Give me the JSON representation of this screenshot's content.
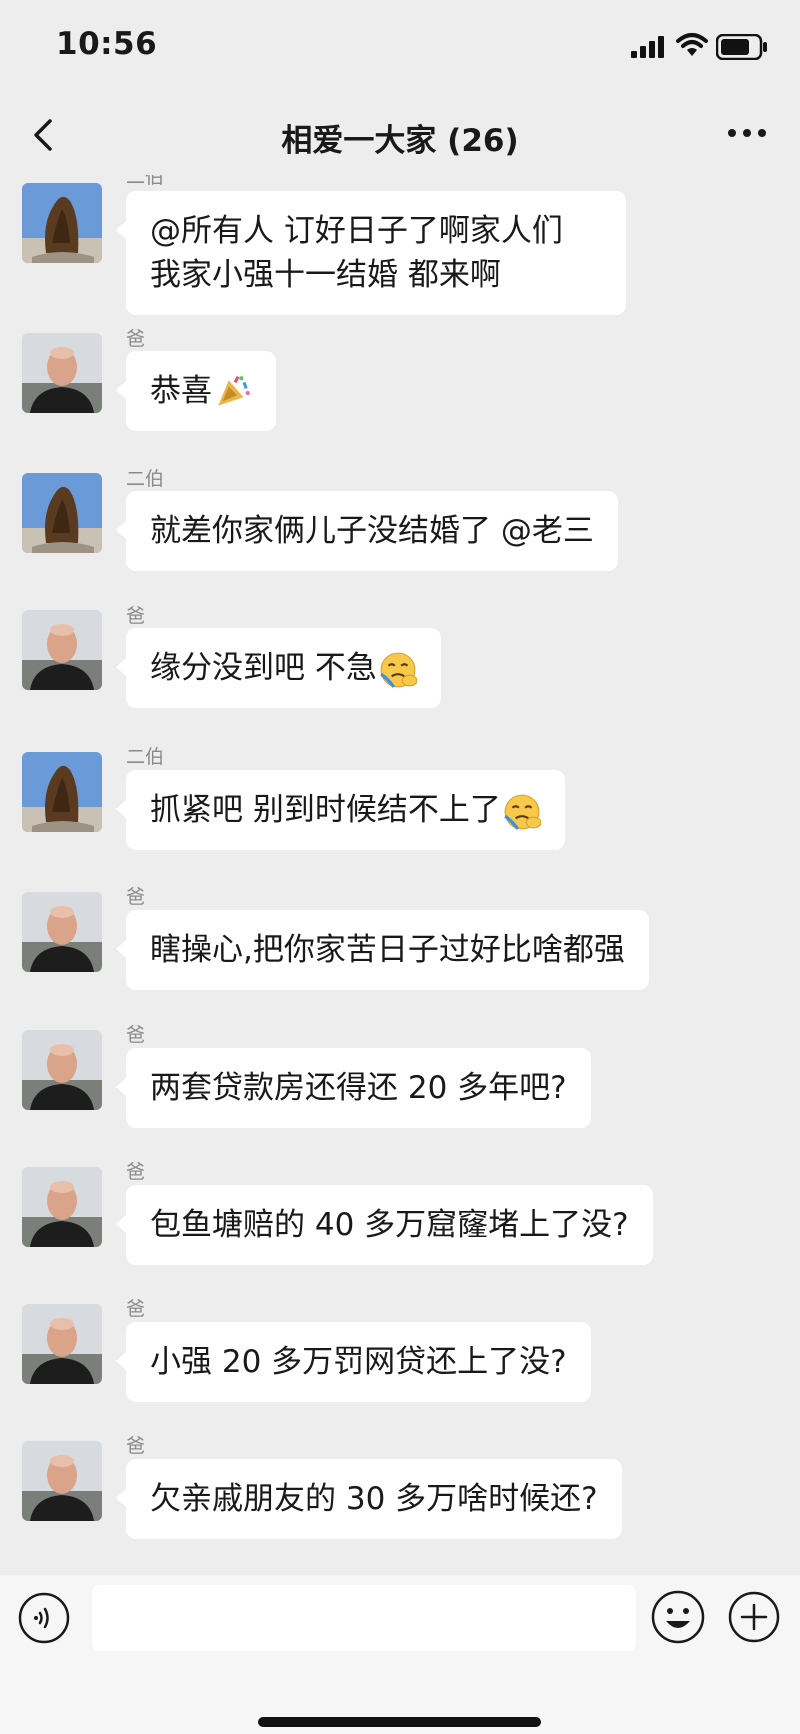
{
  "status_bar": {
    "time": "10:56"
  },
  "header": {
    "title": "相爱一大家 (26)"
  },
  "messages": [
    {
      "sender": "二伯",
      "avatar": "rock-avatar",
      "text": "@所有人 订好日子了啊家人们 我家小强十一结婚  都来啊",
      "emoji": null
    },
    {
      "sender": "爸",
      "avatar": "man-avatar",
      "text": "恭喜",
      "emoji": "party-popper-icon"
    },
    {
      "sender": "二伯",
      "avatar": "rock-avatar",
      "text": "就差你家俩儿子没结婚了 @老三",
      "emoji": null
    },
    {
      "sender": "爸",
      "avatar": "man-avatar",
      "text": "缘分没到吧 不急",
      "emoji": "crying-face-icon"
    },
    {
      "sender": "二伯",
      "avatar": "rock-avatar",
      "text": "抓紧吧 别到时候结不上了",
      "emoji": "crying-face-icon"
    },
    {
      "sender": "爸",
      "avatar": "man-avatar",
      "text": "瞎操心,把你家苦日子过好比啥都强",
      "emoji": null
    },
    {
      "sender": "爸",
      "avatar": "man-avatar",
      "text": "两套贷款房还得还 20 多年吧?",
      "emoji": null
    },
    {
      "sender": "爸",
      "avatar": "man-avatar",
      "text": "包鱼塘赔的 40 多万窟窿堵上了没?",
      "emoji": null
    },
    {
      "sender": "爸",
      "avatar": "man-avatar",
      "text": "小强 20 多万罚网贷还上了没?",
      "emoji": null
    },
    {
      "sender": "爸",
      "avatar": "man-avatar",
      "text": "欠亲戚朋友的 30 多万啥时候还?",
      "emoji": null
    }
  ],
  "input_bar": {
    "placeholder": ""
  },
  "colors": {
    "background": "#ededed",
    "bubble": "#ffffff",
    "sender": "#8a8a8a",
    "text": "#191919"
  }
}
